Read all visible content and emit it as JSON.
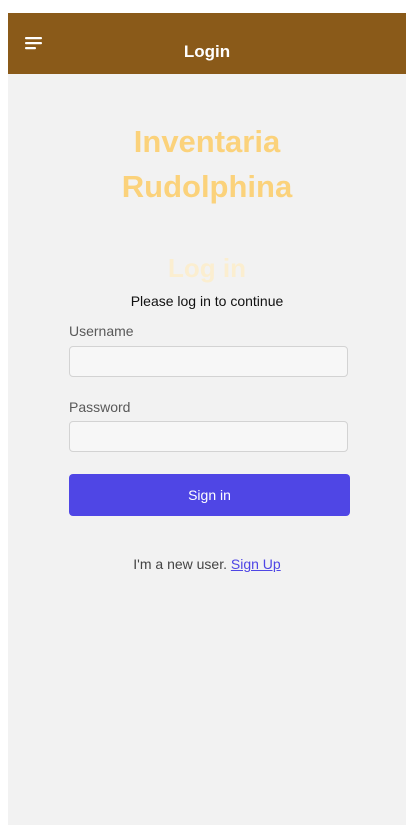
{
  "header": {
    "title": "Login",
    "menu_icon": "hamburger-menu-icon",
    "background_color": "#8a5a19"
  },
  "app": {
    "title_line1": "Inventaria",
    "title_line2": "Rudolphina",
    "title_color": "#fbd27b"
  },
  "form": {
    "heading": "Log in",
    "subtitle": "Please log in to continue",
    "username_label": "Username",
    "username_value": "",
    "password_label": "Password",
    "password_value": "",
    "submit_label": "Sign in",
    "submit_color": "#4f46e5"
  },
  "signup": {
    "prompt": "I'm a new user.",
    "link_label": "Sign Up"
  }
}
